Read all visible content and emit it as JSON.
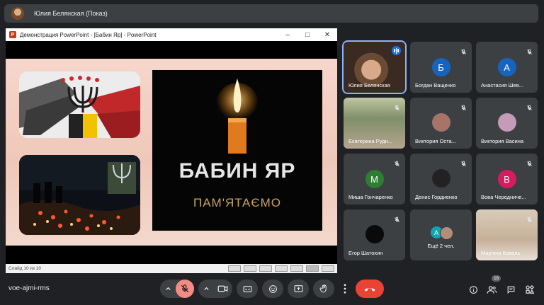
{
  "top_bar": {
    "presenter": "Юлия Белянская (Показ)"
  },
  "presentation": {
    "window_title": "Демонстрация PowerPoint - [Бабин Яр] - PowerPoint",
    "app_icon_letter": "P",
    "slide_title": "БАБИН ЯР",
    "slide_subtitle": "ПАМ'ЯТАЄМО",
    "status_slide": "Слайд 10 из 10"
  },
  "participants": [
    {
      "name": "Юлия Белянская",
      "type": "video",
      "speaking": true
    },
    {
      "name": "Богдан Ващенко",
      "type": "letter",
      "letter": "Б",
      "color": "#1565c0"
    },
    {
      "name": "Анастасия Шев...",
      "type": "letter",
      "letter": "А",
      "color": "#1565c0"
    },
    {
      "name": "Екатерина Рудн...",
      "type": "video"
    },
    {
      "name": "Виктория Оста...",
      "type": "photo"
    },
    {
      "name": "Виктория Васина",
      "type": "photo"
    },
    {
      "name": "Миша Гончаренко",
      "type": "letter",
      "letter": "М",
      "color": "#2e7d32"
    },
    {
      "name": "Денис Гордиенко",
      "type": "photo"
    },
    {
      "name": "Вова Чередниче...",
      "type": "letter",
      "letter": "В",
      "color": "#d81b60"
    },
    {
      "name": "Егор Шатохин",
      "type": "photo"
    },
    {
      "name": "Ещё 2 чел.",
      "type": "group",
      "letter": "А"
    },
    {
      "name": "Мар'яна Коваль",
      "type": "video"
    }
  ],
  "meeting": {
    "code": "voe-ajmi-rms",
    "participant_count": "16"
  },
  "colors": {
    "accent": "#8ab4f8",
    "end_call": "#ea4335",
    "mic_off": "#f28b82"
  }
}
